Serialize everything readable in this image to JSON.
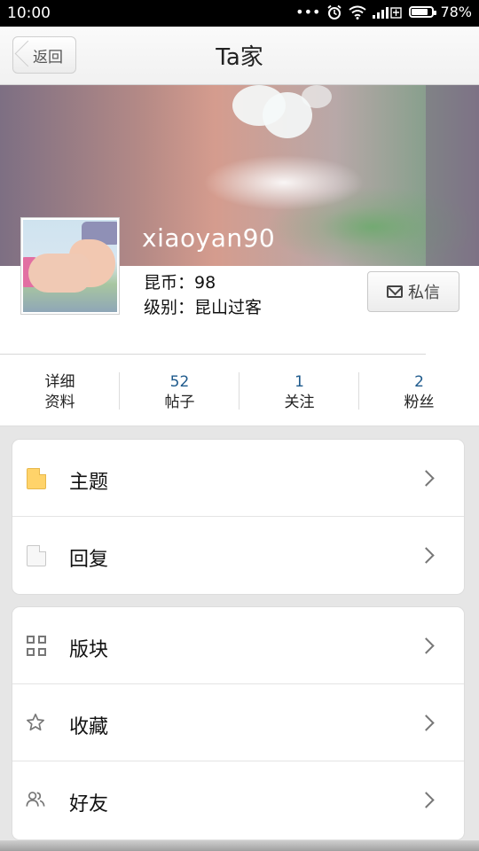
{
  "status_bar": {
    "time": "10:00",
    "dots": "•••",
    "battery_percent": "78%",
    "battery_level": 0.78
  },
  "header": {
    "back_label": "返回",
    "title": "Ta家"
  },
  "profile": {
    "username": "xiaoyan90",
    "coins": "昆币：98",
    "level": "级别：昆山过客",
    "message_button": "私信"
  },
  "stats": [
    {
      "number": "",
      "label_top": "详细",
      "label": "资料"
    },
    {
      "number": "52",
      "label": "帖子"
    },
    {
      "number": "1",
      "label": "关注"
    },
    {
      "number": "2",
      "label": "粉丝"
    }
  ],
  "menu_group1": [
    {
      "icon": "folder-icon",
      "label": "主题"
    },
    {
      "icon": "document-icon",
      "label": "回复"
    }
  ],
  "menu_group2": [
    {
      "icon": "grid-icon",
      "label": "版块"
    },
    {
      "icon": "star-icon",
      "label": "收藏"
    },
    {
      "icon": "friends-icon",
      "label": "好友"
    }
  ],
  "colors": {
    "stat_number": "#1e5a8c",
    "folder": "#ffd36a"
  }
}
